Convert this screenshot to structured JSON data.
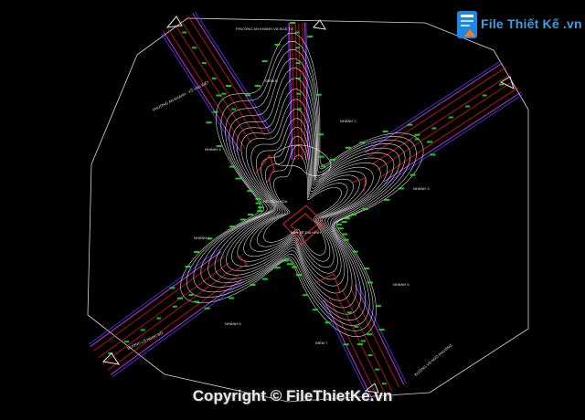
{
  "drawing": {
    "title_top": "PHƯỜNG AN KHÁNH VÀ NGÃ TƯ",
    "title_left": "PHƯỜNG AN KHÁNH - VÕ VĂN KIỆT",
    "left_road_label": "ĐƯỜNG LỐ NGỌC BỒ",
    "bottom_road_label": "ĐƯỜNG VÕ NGÔ PHƯỜNG",
    "center_label_1": "HỒ ĐIỀU HÒA",
    "center_label_2": "BẢN VẼ ĐỊA HÌNH",
    "tags": [
      "NHÁNH 2",
      "NHÁNH 4",
      "NHÁNH 3",
      "NHÁNH 1",
      "NHÁNH 5",
      "NHÁNH 6",
      "ĐIỂM 7",
      "ĐIỂM B"
    ],
    "line_colors": {
      "contour": "#ffffff",
      "road_red": "#e01515",
      "road_blue": "#4040ff",
      "road_magenta": "#ff33ff",
      "points": "#19e619",
      "highlight": "#ff2020"
    }
  },
  "branding": {
    "logo_text": "File Thiết Kế .vn",
    "copyright": "Copyright © FileThietKe.vn"
  }
}
